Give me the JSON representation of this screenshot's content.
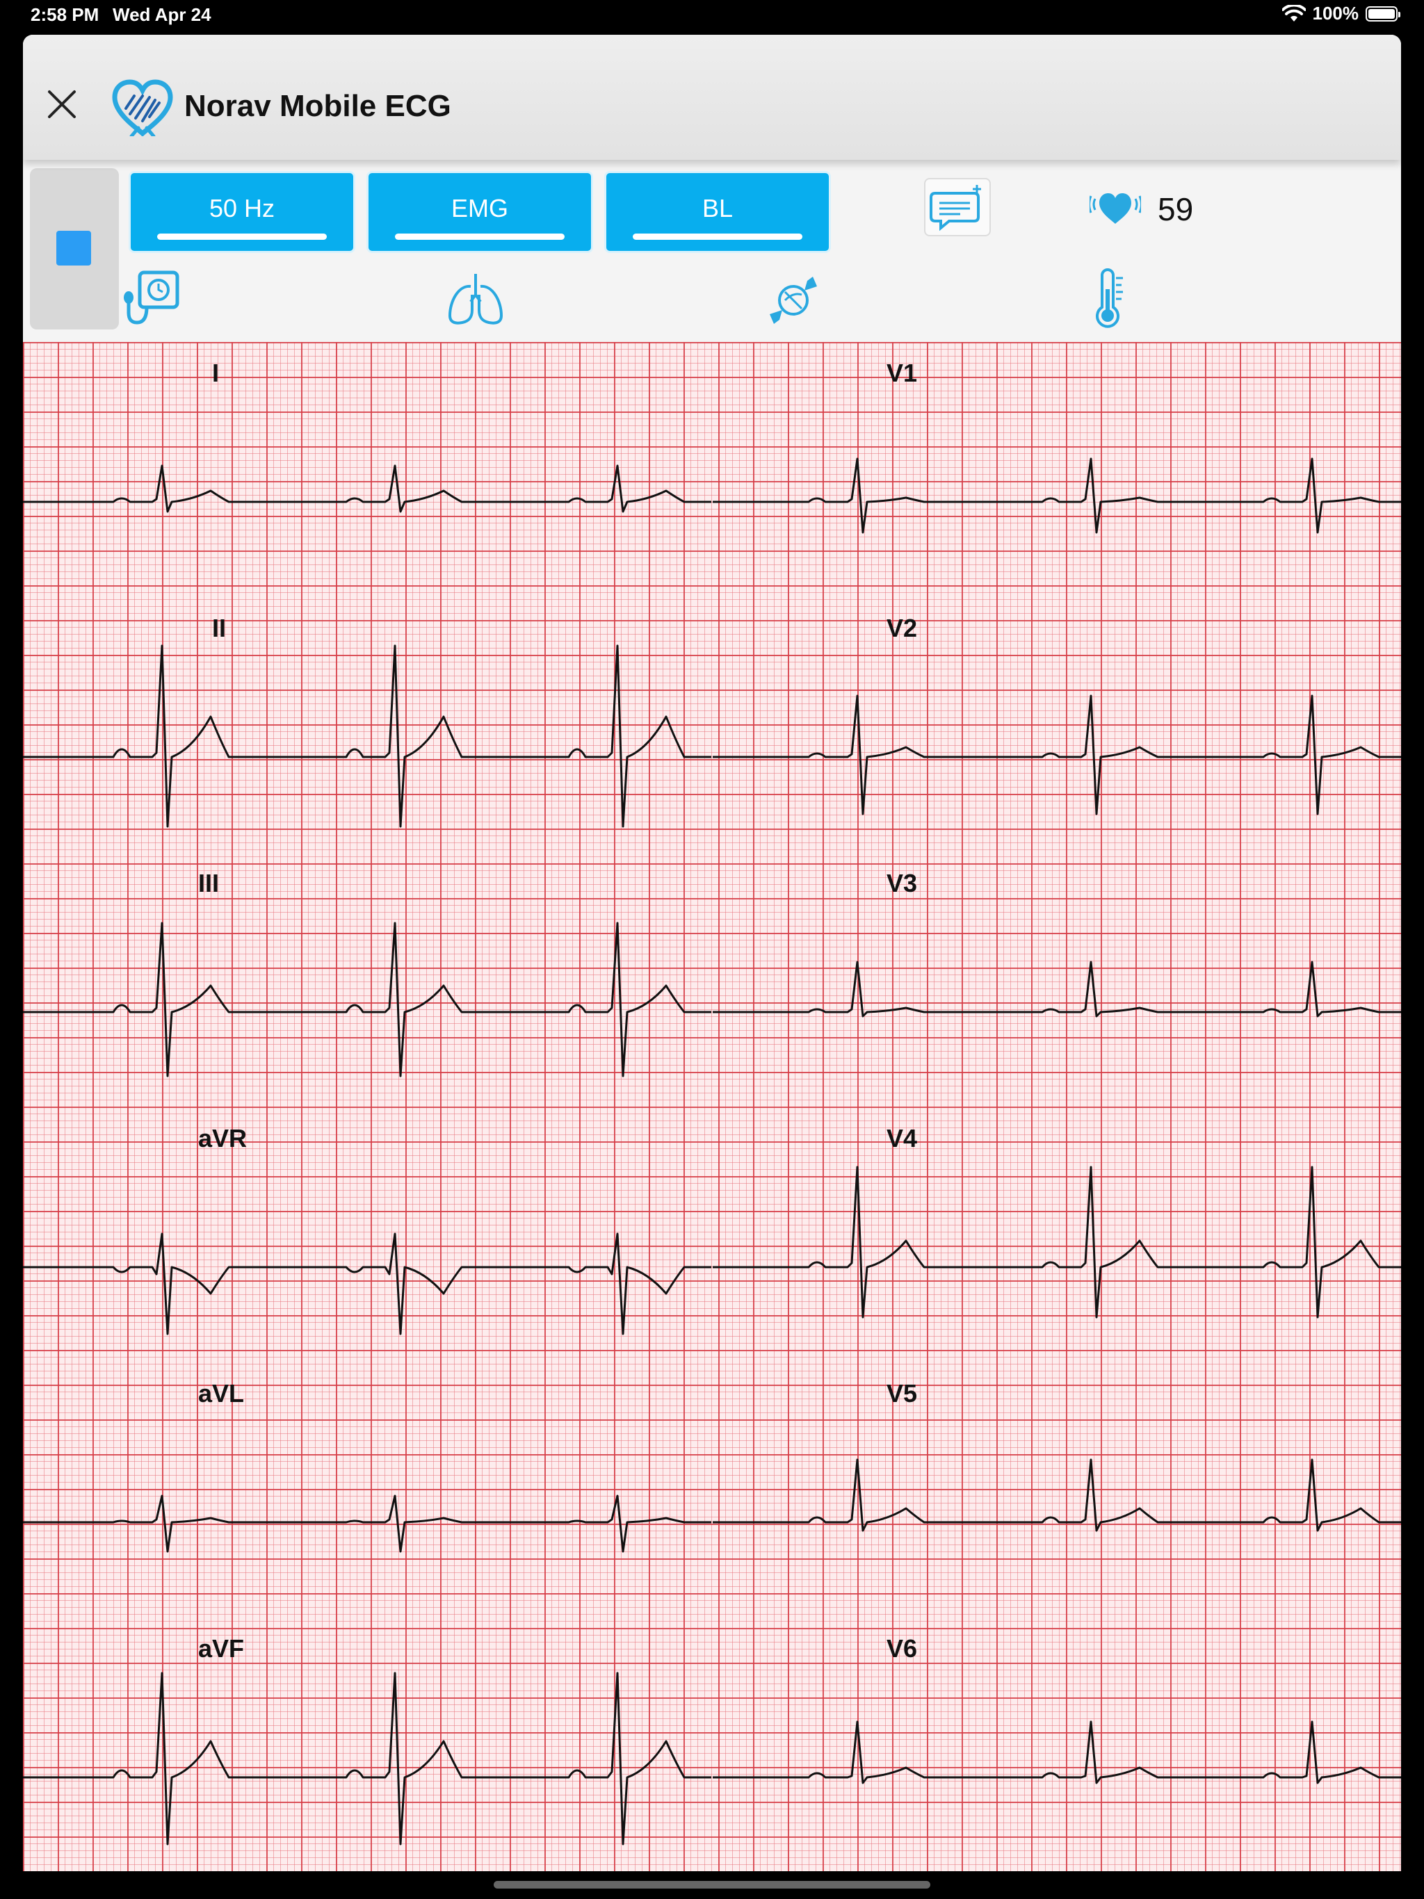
{
  "status_bar": {
    "time": "2:58 PM",
    "date": "Wed Apr 24",
    "battery": "100%",
    "battery_level": 1.0
  },
  "app": {
    "title": "Norav Mobile ECG"
  },
  "filters": [
    {
      "label": "50 Hz"
    },
    {
      "label": "EMG"
    },
    {
      "label": "BL"
    }
  ],
  "heart_rate": "59",
  "icons": {
    "close": "close-icon",
    "logo": "heart-logo-icon",
    "stop": "stop-square-icon",
    "comment": "comment-add-icon",
    "heart_rate": "heart-icon",
    "blood_pressure": "blood-pressure-icon",
    "lungs": "lungs-icon",
    "glucose": "candy-icon",
    "temperature": "thermometer-icon"
  },
  "colors": {
    "accent": "#08aeee",
    "stop": "#2b9df4",
    "grid_major": "#d63c46",
    "grid_minor": "#e87880",
    "paper": "#fdeced",
    "trace": "#111111"
  },
  "leads": {
    "left": [
      "I",
      "II",
      "III",
      "aVR",
      "aVL",
      "aVF"
    ],
    "right": [
      "V1",
      "V2",
      "V3",
      "V4",
      "V5",
      "V6"
    ]
  }
}
